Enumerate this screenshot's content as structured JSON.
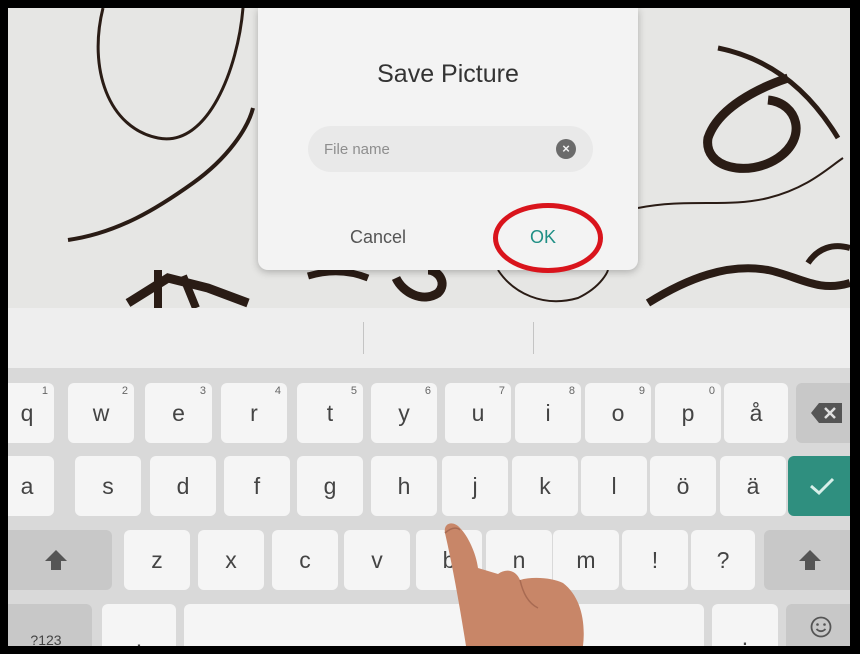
{
  "dialog": {
    "title": "Save Picture",
    "file_name_placeholder": "File name",
    "file_name_value": "",
    "cancel_label": "Cancel",
    "ok_label": "OK"
  },
  "keyboard": {
    "row1": [
      {
        "label": "q",
        "hint": "1"
      },
      {
        "label": "w",
        "hint": "2"
      },
      {
        "label": "e",
        "hint": "3"
      },
      {
        "label": "r",
        "hint": "4"
      },
      {
        "label": "t",
        "hint": "5"
      },
      {
        "label": "y",
        "hint": "6"
      },
      {
        "label": "u",
        "hint": "7"
      },
      {
        "label": "i",
        "hint": "8"
      },
      {
        "label": "o",
        "hint": "9"
      },
      {
        "label": "p",
        "hint": "0"
      },
      {
        "label": "å",
        "hint": ""
      }
    ],
    "row2": [
      "a",
      "s",
      "d",
      "f",
      "g",
      "h",
      "j",
      "k",
      "l",
      "ö",
      "ä"
    ],
    "row3": [
      "z",
      "x",
      "c",
      "v",
      "b",
      "n",
      "m",
      "!",
      "?"
    ],
    "symbols_label": "?123",
    "comma_label": ",",
    "period_label": ".",
    "backspace_icon": "backspace-icon",
    "enter_icon": "checkmark-icon",
    "shift_icon": "shift-up-arrow-icon",
    "emoji_icon": "emoji-icon"
  },
  "colors": {
    "ok_text": "#1f8f85",
    "highlight_circle": "#d9141c",
    "enter_key": "#2f8f7f"
  }
}
